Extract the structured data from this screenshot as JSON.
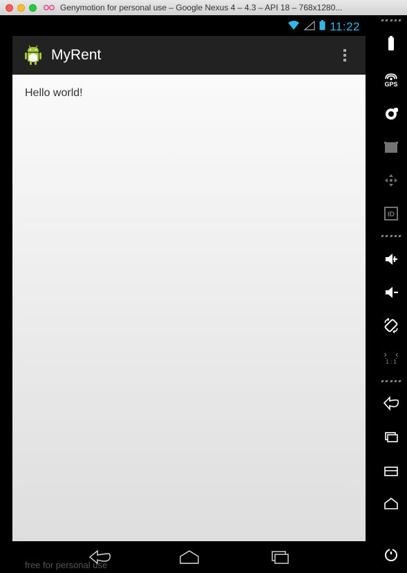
{
  "window": {
    "title": "Genymotion for personal use – Google Nexus 4 – 4.3 – API 18 – 768x1280..."
  },
  "statusbar": {
    "time": "11:22"
  },
  "actionbar": {
    "title": "MyRent"
  },
  "content": {
    "body_text": "Hello world!"
  },
  "footer": {
    "watermark": "free for personal use"
  },
  "right_toolbar": {
    "gps_label": "GPS",
    "id_label": "ID",
    "pixel_label": "1 : 1"
  }
}
